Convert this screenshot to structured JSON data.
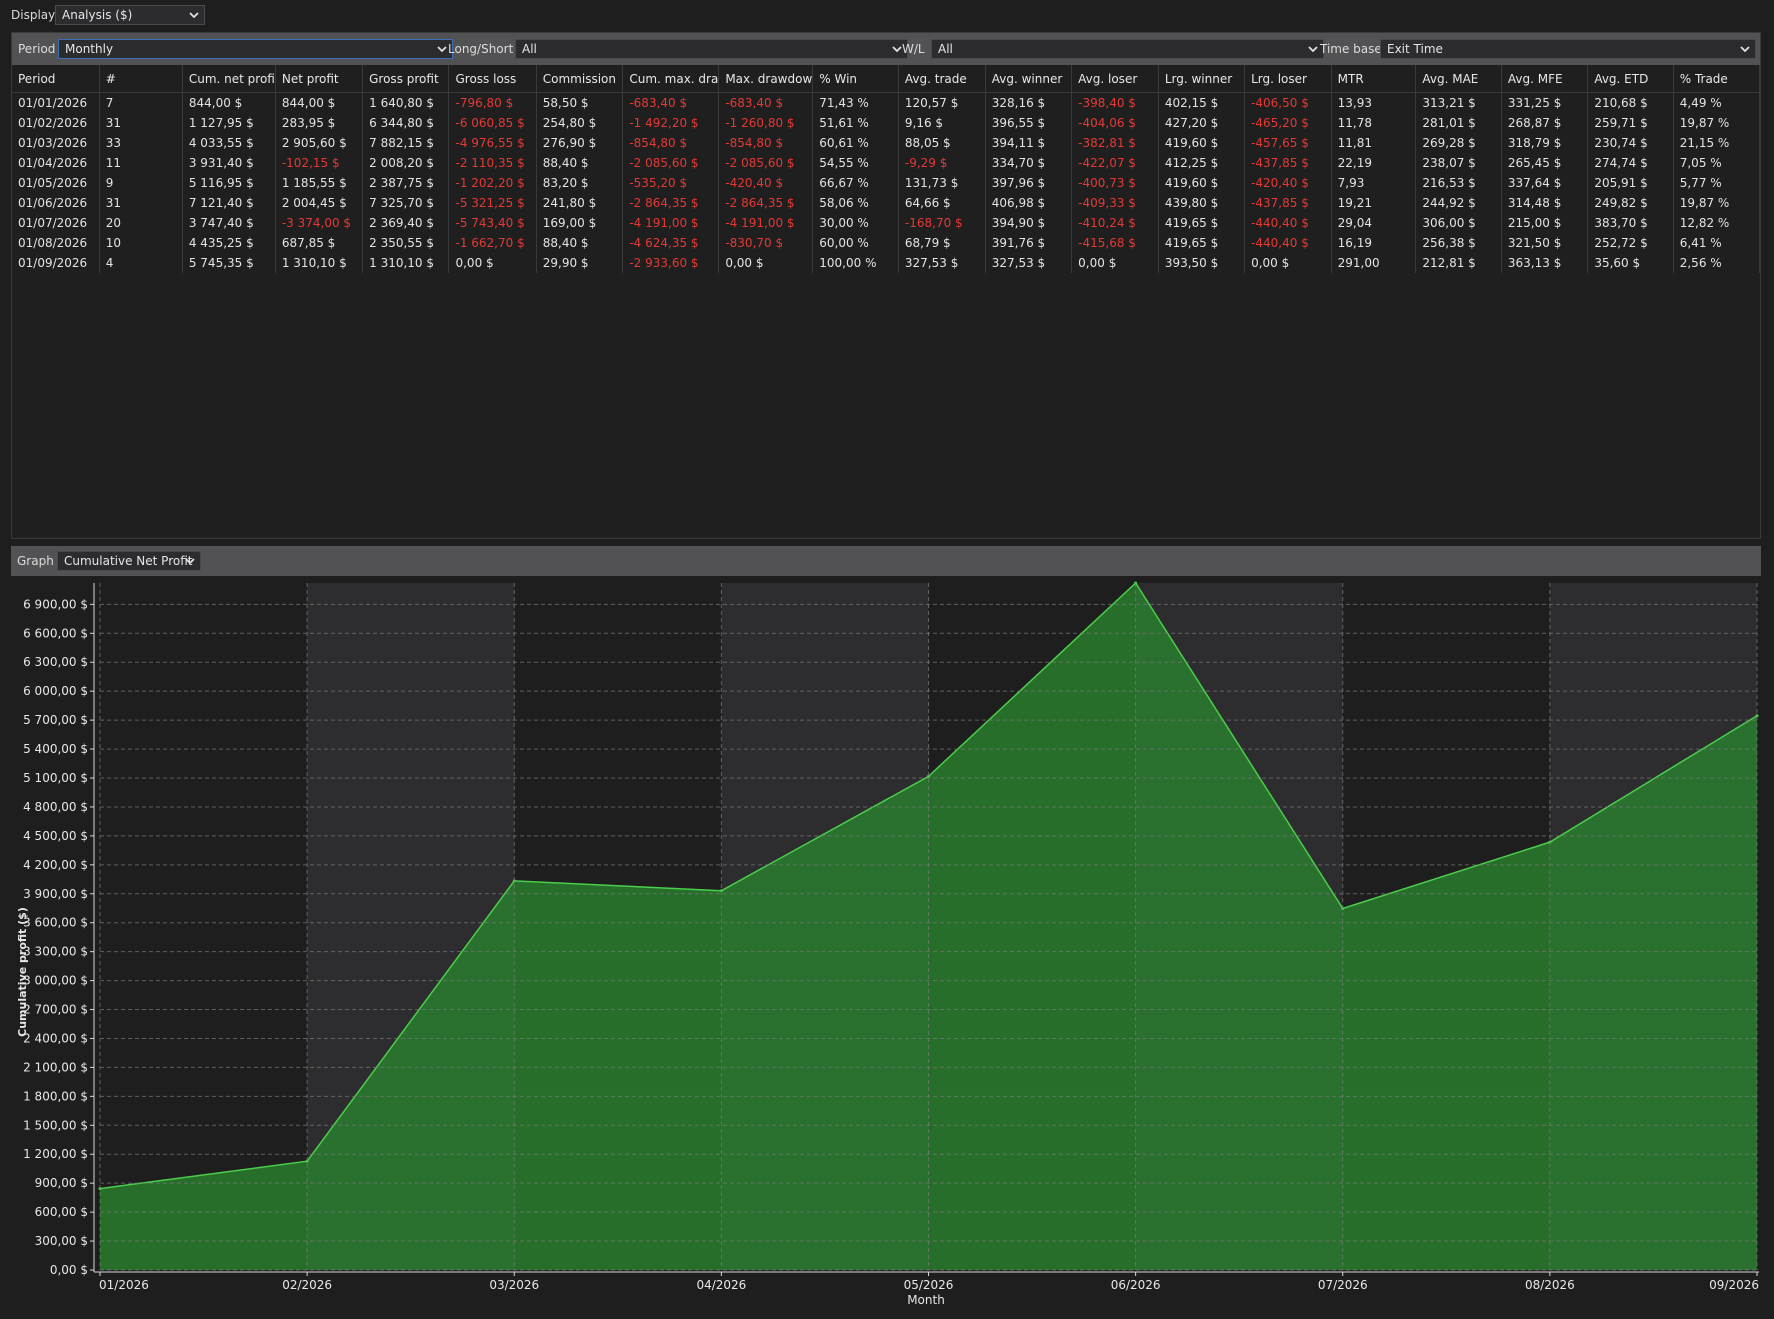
{
  "display": {
    "label": "Display",
    "value": "Analysis ($)"
  },
  "filters": {
    "period_label": "Period",
    "period_value": "Monthly",
    "longshort_label": "Long/Short",
    "longshort_value": "All",
    "wl_label": "W/L",
    "wl_value": "All",
    "timebase_label": "Time base",
    "timebase_value": "Exit Time"
  },
  "table": {
    "headers": [
      "Period",
      "#",
      "Cum. net profi",
      "Net profit",
      "Gross profit",
      "Gross loss",
      "Commission",
      "Cum. max. dra",
      "Max. drawdow",
      "% Win",
      "Avg. trade",
      "Avg. winner",
      "Avg. loser",
      "Lrg. winner",
      "Lrg. loser",
      "MTR",
      "Avg. MAE",
      "Avg. MFE",
      "Avg. ETD",
      "% Trade"
    ],
    "rows": [
      [
        "01/01/2026",
        "7",
        "844,00 $",
        "844,00 $",
        "1 640,80 $",
        "-796,80 $",
        "58,50 $",
        "-683,40 $",
        "-683,40 $",
        "71,43 %",
        "120,57 $",
        "328,16 $",
        "-398,40 $",
        "402,15 $",
        "-406,50 $",
        "13,93",
        "313,21 $",
        "331,25 $",
        "210,68 $",
        "4,49 %"
      ],
      [
        "01/02/2026",
        "31",
        "1 127,95 $",
        "283,95 $",
        "6 344,80 $",
        "-6 060,85 $",
        "254,80 $",
        "-1 492,20 $",
        "-1 260,80 $",
        "51,61 %",
        "9,16 $",
        "396,55 $",
        "-404,06 $",
        "427,20 $",
        "-465,20 $",
        "11,78",
        "281,01 $",
        "268,87 $",
        "259,71 $",
        "19,87 %"
      ],
      [
        "01/03/2026",
        "33",
        "4 033,55 $",
        "2 905,60 $",
        "7 882,15 $",
        "-4 976,55 $",
        "276,90 $",
        "-854,80 $",
        "-854,80 $",
        "60,61 %",
        "88,05 $",
        "394,11 $",
        "-382,81 $",
        "419,60 $",
        "-457,65 $",
        "11,81",
        "269,28 $",
        "318,79 $",
        "230,74 $",
        "21,15 %"
      ],
      [
        "01/04/2026",
        "11",
        "3 931,40 $",
        "-102,15 $",
        "2 008,20 $",
        "-2 110,35 $",
        "88,40 $",
        "-2 085,60 $",
        "-2 085,60 $",
        "54,55 %",
        "-9,29 $",
        "334,70 $",
        "-422,07 $",
        "412,25 $",
        "-437,85 $",
        "22,19",
        "238,07 $",
        "265,45 $",
        "274,74 $",
        "7,05 %"
      ],
      [
        "01/05/2026",
        "9",
        "5 116,95 $",
        "1 185,55 $",
        "2 387,75 $",
        "-1 202,20 $",
        "83,20 $",
        "-535,20 $",
        "-420,40 $",
        "66,67 %",
        "131,73 $",
        "397,96 $",
        "-400,73 $",
        "419,60 $",
        "-420,40 $",
        "7,93",
        "216,53 $",
        "337,64 $",
        "205,91 $",
        "5,77 %"
      ],
      [
        "01/06/2026",
        "31",
        "7 121,40 $",
        "2 004,45 $",
        "7 325,70 $",
        "-5 321,25 $",
        "241,80 $",
        "-2 864,35 $",
        "-2 864,35 $",
        "58,06 %",
        "64,66 $",
        "406,98 $",
        "-409,33 $",
        "439,80 $",
        "-437,85 $",
        "19,21",
        "244,92 $",
        "314,48 $",
        "249,82 $",
        "19,87 %"
      ],
      [
        "01/07/2026",
        "20",
        "3 747,40 $",
        "-3 374,00 $",
        "2 369,40 $",
        "-5 743,40 $",
        "169,00 $",
        "-4 191,00 $",
        "-4 191,00 $",
        "30,00 %",
        "-168,70 $",
        "394,90 $",
        "-410,24 $",
        "419,65 $",
        "-440,40 $",
        "29,04",
        "306,00 $",
        "215,00 $",
        "383,70 $",
        "12,82 %"
      ],
      [
        "01/08/2026",
        "10",
        "4 435,25 $",
        "687,85 $",
        "2 350,55 $",
        "-1 662,70 $",
        "88,40 $",
        "-4 624,35 $",
        "-830,70 $",
        "60,00 %",
        "68,79 $",
        "391,76 $",
        "-415,68 $",
        "419,65 $",
        "-440,40 $",
        "16,19",
        "256,38 $",
        "321,50 $",
        "252,72 $",
        "6,41 %"
      ],
      [
        "01/09/2026",
        "4",
        "5 745,35 $",
        "1 310,10 $",
        "1 310,10 $",
        "0,00 $",
        "29,90 $",
        "-2 933,60 $",
        "0,00 $",
        "100,00 %",
        "327,53 $",
        "327,53 $",
        "0,00 $",
        "393,50 $",
        "0,00 $",
        "291,00",
        "212,81 $",
        "363,13 $",
        "35,60 $",
        "2,56 %"
      ]
    ]
  },
  "graph": {
    "label": "Graph",
    "value": "Cumulative Net Profit"
  },
  "colors": {
    "negative": "#e53935",
    "area_fill": "#2a7d2e",
    "area_line": "#4ccd4c",
    "band": "#2d2d2f",
    "background": "#1e1e1f"
  },
  "chart_data": {
    "type": "area",
    "x": [
      "01/2026",
      "02/2026",
      "03/2026",
      "04/2026",
      "05/2026",
      "06/2026",
      "07/2026",
      "08/2026",
      "09/2026"
    ],
    "values": [
      844.0,
      1127.95,
      4033.55,
      3931.4,
      5116.95,
      7121.4,
      3747.4,
      4435.25,
      5745.35
    ],
    "ylabel": "Cumulative profit ($)",
    "xlabel": "Month",
    "yticks": [
      0,
      300,
      600,
      900,
      1200,
      1500,
      1800,
      2100,
      2400,
      2700,
      3000,
      3300,
      3600,
      3900,
      4200,
      4500,
      4800,
      5100,
      5400,
      5700,
      6000,
      6300,
      6600,
      6900
    ],
    "ytick_labels": [
      "0,00 $",
      "300,00 $",
      "600,00 $",
      "900,00 $",
      "1 200,00 $",
      "1 500,00 $",
      "1 800,00 $",
      "2 100,00 $",
      "2 400,00 $",
      "2 700,00 $",
      "3 000,00 $",
      "3 300,00 $",
      "3 600,00 $",
      "3 900,00 $",
      "4 200,00 $",
      "4 500,00 $",
      "4 800,00 $",
      "5 100,00 $",
      "5 400,00 $",
      "5 700,00 $",
      "6 000,00 $",
      "6 300,00 $",
      "6 600,00 $",
      "6 900,00 $"
    ],
    "ylim": [
      0,
      7121.4
    ],
    "grid": true,
    "legend": "none"
  }
}
